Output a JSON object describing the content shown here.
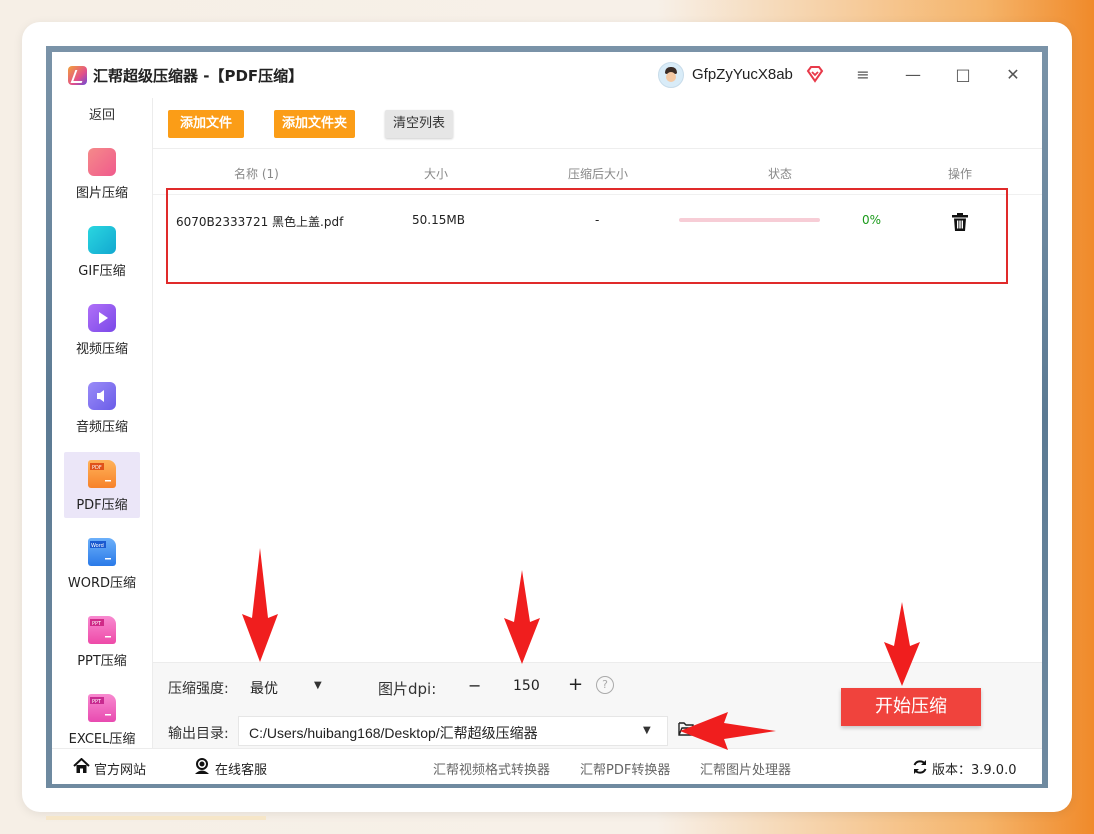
{
  "window": {
    "title": "汇帮超级压缩器  -【PDF压缩】",
    "username": "GfpZyYucX8ab",
    "controls": {
      "menu": "≡",
      "minimize": "—",
      "maximize": "□",
      "close": "✕"
    }
  },
  "sidebar": {
    "back": "返回",
    "items": [
      {
        "label": "图片压缩",
        "icon": "image-icon",
        "color": "#f06a8c"
      },
      {
        "label": "GIF压缩",
        "icon": "gif-icon",
        "color": "#1fc2d8"
      },
      {
        "label": "视频压缩",
        "icon": "video-play-icon",
        "color": "#9a5cf0"
      },
      {
        "label": "音频压缩",
        "icon": "audio-speaker-icon",
        "color": "#7c6cf0"
      },
      {
        "label": "PDF压缩",
        "icon": "pdf-file-icon",
        "color": "#f98a2a",
        "active": true
      },
      {
        "label": "WORD压缩",
        "icon": "word-file-icon",
        "color": "#3c8df0"
      },
      {
        "label": "PPT压缩",
        "icon": "ppt-file-icon",
        "color": "#f05ab2"
      },
      {
        "label": "EXCEL压缩",
        "icon": "excel-file-icon",
        "color": "#e85ab6"
      }
    ]
  },
  "toolbar": {
    "add_file": "添加文件",
    "add_folder": "添加文件夹",
    "clear_list": "清空列表"
  },
  "table": {
    "headers": [
      "名称 (1)",
      "大小",
      "压缩后大小",
      "状态",
      "操作"
    ],
    "rows": [
      {
        "name": "6070B2333721 黑色上盖.pdf",
        "size": "50.15MB",
        "compressed_size": "-",
        "progress": 0.0,
        "percent": "0%"
      }
    ]
  },
  "settings": {
    "strength_label": "压缩强度:",
    "strength_value": "最优",
    "dpi_label": "图片dpi:",
    "dpi_minus": "−",
    "dpi_value": "150",
    "dpi_plus": "+",
    "help": "?",
    "output_label": "输出目录:",
    "output_path": "C:/Users/huibang168/Desktop/汇帮超级压缩器",
    "start_button": "开始压缩"
  },
  "footer": {
    "website": "官方网站",
    "support": "在线客服",
    "link1": "汇帮视频格式转换器",
    "link2": "汇帮PDF转换器",
    "link3": "汇帮图片处理器",
    "version": "版本：3.9.0.0"
  },
  "colors": {
    "accent_orange": "#fb9d17",
    "start_red": "#f0433d",
    "highlight_red": "#e02a2a",
    "progress_pink": "#f7cdd6",
    "percent_green": "#1a9a1a"
  }
}
